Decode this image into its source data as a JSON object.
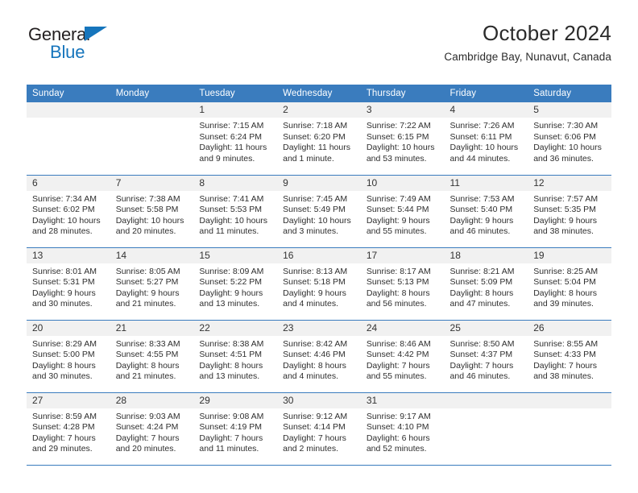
{
  "logo": {
    "word_top": "General",
    "word_bottom": "Blue",
    "triangle_color": "#1675bc",
    "icon": "triangle-icon"
  },
  "header": {
    "title": "October 2024",
    "subtitle": "Cambridge Bay, Nunavut, Canada"
  },
  "theme": {
    "header_blue": "#3a7cbe",
    "daynum_gray": "#f1f1f1",
    "text": "#2e2e2e"
  },
  "weekdays": [
    "Sunday",
    "Monday",
    "Tuesday",
    "Wednesday",
    "Thursday",
    "Friday",
    "Saturday"
  ],
  "weeks": [
    [
      {
        "day": ""
      },
      {
        "day": ""
      },
      {
        "day": "1",
        "sunrise": "Sunrise: 7:15 AM",
        "sunset": "Sunset: 6:24 PM",
        "daylight": "Daylight: 11 hours and 9 minutes."
      },
      {
        "day": "2",
        "sunrise": "Sunrise: 7:18 AM",
        "sunset": "Sunset: 6:20 PM",
        "daylight": "Daylight: 11 hours and 1 minute."
      },
      {
        "day": "3",
        "sunrise": "Sunrise: 7:22 AM",
        "sunset": "Sunset: 6:15 PM",
        "daylight": "Daylight: 10 hours and 53 minutes."
      },
      {
        "day": "4",
        "sunrise": "Sunrise: 7:26 AM",
        "sunset": "Sunset: 6:11 PM",
        "daylight": "Daylight: 10 hours and 44 minutes."
      },
      {
        "day": "5",
        "sunrise": "Sunrise: 7:30 AM",
        "sunset": "Sunset: 6:06 PM",
        "daylight": "Daylight: 10 hours and 36 minutes."
      }
    ],
    [
      {
        "day": "6",
        "sunrise": "Sunrise: 7:34 AM",
        "sunset": "Sunset: 6:02 PM",
        "daylight": "Daylight: 10 hours and 28 minutes."
      },
      {
        "day": "7",
        "sunrise": "Sunrise: 7:38 AM",
        "sunset": "Sunset: 5:58 PM",
        "daylight": "Daylight: 10 hours and 20 minutes."
      },
      {
        "day": "8",
        "sunrise": "Sunrise: 7:41 AM",
        "sunset": "Sunset: 5:53 PM",
        "daylight": "Daylight: 10 hours and 11 minutes."
      },
      {
        "day": "9",
        "sunrise": "Sunrise: 7:45 AM",
        "sunset": "Sunset: 5:49 PM",
        "daylight": "Daylight: 10 hours and 3 minutes."
      },
      {
        "day": "10",
        "sunrise": "Sunrise: 7:49 AM",
        "sunset": "Sunset: 5:44 PM",
        "daylight": "Daylight: 9 hours and 55 minutes."
      },
      {
        "day": "11",
        "sunrise": "Sunrise: 7:53 AM",
        "sunset": "Sunset: 5:40 PM",
        "daylight": "Daylight: 9 hours and 46 minutes."
      },
      {
        "day": "12",
        "sunrise": "Sunrise: 7:57 AM",
        "sunset": "Sunset: 5:35 PM",
        "daylight": "Daylight: 9 hours and 38 minutes."
      }
    ],
    [
      {
        "day": "13",
        "sunrise": "Sunrise: 8:01 AM",
        "sunset": "Sunset: 5:31 PM",
        "daylight": "Daylight: 9 hours and 30 minutes."
      },
      {
        "day": "14",
        "sunrise": "Sunrise: 8:05 AM",
        "sunset": "Sunset: 5:27 PM",
        "daylight": "Daylight: 9 hours and 21 minutes."
      },
      {
        "day": "15",
        "sunrise": "Sunrise: 8:09 AM",
        "sunset": "Sunset: 5:22 PM",
        "daylight": "Daylight: 9 hours and 13 minutes."
      },
      {
        "day": "16",
        "sunrise": "Sunrise: 8:13 AM",
        "sunset": "Sunset: 5:18 PM",
        "daylight": "Daylight: 9 hours and 4 minutes."
      },
      {
        "day": "17",
        "sunrise": "Sunrise: 8:17 AM",
        "sunset": "Sunset: 5:13 PM",
        "daylight": "Daylight: 8 hours and 56 minutes."
      },
      {
        "day": "18",
        "sunrise": "Sunrise: 8:21 AM",
        "sunset": "Sunset: 5:09 PM",
        "daylight": "Daylight: 8 hours and 47 minutes."
      },
      {
        "day": "19",
        "sunrise": "Sunrise: 8:25 AM",
        "sunset": "Sunset: 5:04 PM",
        "daylight": "Daylight: 8 hours and 39 minutes."
      }
    ],
    [
      {
        "day": "20",
        "sunrise": "Sunrise: 8:29 AM",
        "sunset": "Sunset: 5:00 PM",
        "daylight": "Daylight: 8 hours and 30 minutes."
      },
      {
        "day": "21",
        "sunrise": "Sunrise: 8:33 AM",
        "sunset": "Sunset: 4:55 PM",
        "daylight": "Daylight: 8 hours and 21 minutes."
      },
      {
        "day": "22",
        "sunrise": "Sunrise: 8:38 AM",
        "sunset": "Sunset: 4:51 PM",
        "daylight": "Daylight: 8 hours and 13 minutes."
      },
      {
        "day": "23",
        "sunrise": "Sunrise: 8:42 AM",
        "sunset": "Sunset: 4:46 PM",
        "daylight": "Daylight: 8 hours and 4 minutes."
      },
      {
        "day": "24",
        "sunrise": "Sunrise: 8:46 AM",
        "sunset": "Sunset: 4:42 PM",
        "daylight": "Daylight: 7 hours and 55 minutes."
      },
      {
        "day": "25",
        "sunrise": "Sunrise: 8:50 AM",
        "sunset": "Sunset: 4:37 PM",
        "daylight": "Daylight: 7 hours and 46 minutes."
      },
      {
        "day": "26",
        "sunrise": "Sunrise: 8:55 AM",
        "sunset": "Sunset: 4:33 PM",
        "daylight": "Daylight: 7 hours and 38 minutes."
      }
    ],
    [
      {
        "day": "27",
        "sunrise": "Sunrise: 8:59 AM",
        "sunset": "Sunset: 4:28 PM",
        "daylight": "Daylight: 7 hours and 29 minutes."
      },
      {
        "day": "28",
        "sunrise": "Sunrise: 9:03 AM",
        "sunset": "Sunset: 4:24 PM",
        "daylight": "Daylight: 7 hours and 20 minutes."
      },
      {
        "day": "29",
        "sunrise": "Sunrise: 9:08 AM",
        "sunset": "Sunset: 4:19 PM",
        "daylight": "Daylight: 7 hours and 11 minutes."
      },
      {
        "day": "30",
        "sunrise": "Sunrise: 9:12 AM",
        "sunset": "Sunset: 4:14 PM",
        "daylight": "Daylight: 7 hours and 2 minutes."
      },
      {
        "day": "31",
        "sunrise": "Sunrise: 9:17 AM",
        "sunset": "Sunset: 4:10 PM",
        "daylight": "Daylight: 6 hours and 52 minutes."
      },
      {
        "day": ""
      },
      {
        "day": ""
      }
    ]
  ]
}
